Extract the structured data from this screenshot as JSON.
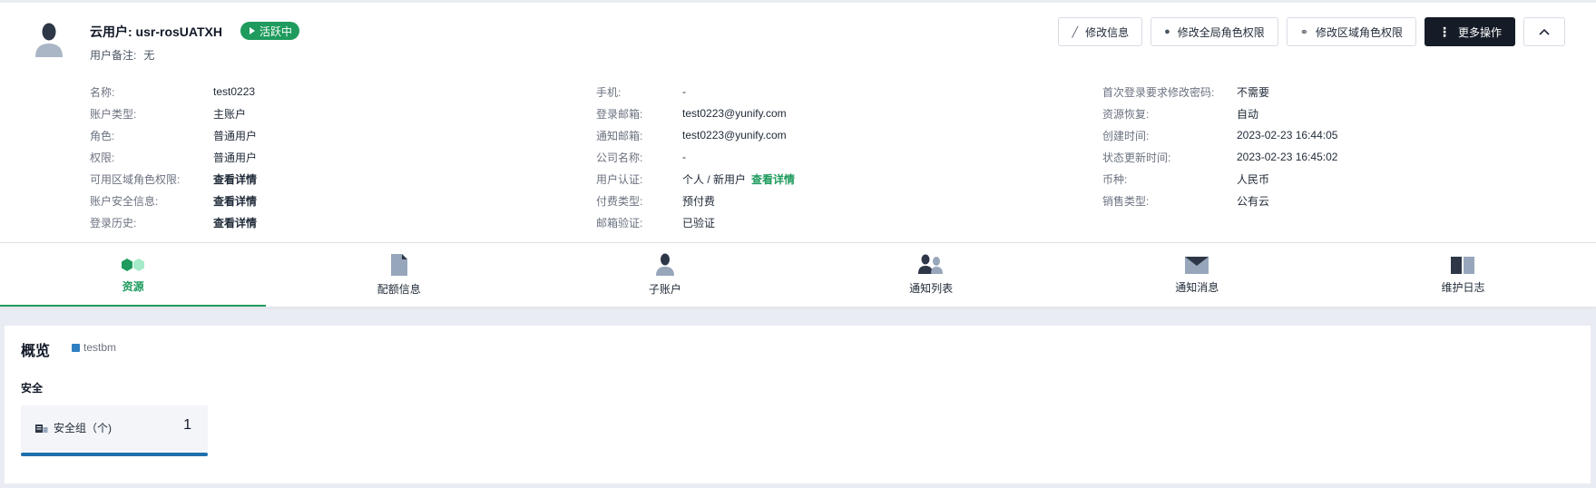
{
  "user": {
    "title": "云用户: usr-rosUATXH",
    "status": "活跃中",
    "remark_label": "用户备注:",
    "remark_value": "无"
  },
  "actions": {
    "edit_info": "修改信息",
    "edit_global_roles": "修改全局角色权限",
    "edit_zone_roles": "修改区域角色权限",
    "more": "更多操作"
  },
  "info": {
    "col1": [
      {
        "k": "名称:",
        "v": "test0223"
      },
      {
        "k": "账户类型:",
        "v": "主账户"
      },
      {
        "k": "角色:",
        "v": "普通用户"
      },
      {
        "k": "权限:",
        "v": "普通用户"
      },
      {
        "k": "可用区域角色权限:",
        "v": "查看详情"
      },
      {
        "k": "账户安全信息:",
        "v": "查看详情"
      },
      {
        "k": "登录历史:",
        "v": "查看详情"
      }
    ],
    "col2": [
      {
        "k": "手机:",
        "v": "-"
      },
      {
        "k": "登录邮箱:",
        "v": "test0223@yunify.com"
      },
      {
        "k": "通知邮箱:",
        "v": "test0223@yunify.com"
      },
      {
        "k": "公司名称:",
        "v": "-"
      },
      {
        "k": "用户认证:",
        "v": "个人 / 新用户",
        "link": "查看详情"
      },
      {
        "k": "付费类型:",
        "v": "预付费"
      },
      {
        "k": "邮箱验证:",
        "v": "已验证"
      }
    ],
    "col3": [
      {
        "k": "首次登录要求修改密码:",
        "v": "不需要"
      },
      {
        "k": "资源恢复:",
        "v": "自动"
      },
      {
        "k": "创建时间:",
        "v": "2023-02-23 16:44:05"
      },
      {
        "k": "状态更新时间:",
        "v": "2023-02-23 16:45:02"
      },
      {
        "k": "币种:",
        "v": "人民币"
      },
      {
        "k": "销售类型:",
        "v": "公有云"
      }
    ]
  },
  "tabs": [
    {
      "label": "资源",
      "icon": "resources-icon"
    },
    {
      "label": "配额信息",
      "icon": "document-icon"
    },
    {
      "label": "子账户",
      "icon": "user-icon"
    },
    {
      "label": "通知列表",
      "icon": "users-icon"
    },
    {
      "label": "通知消息",
      "icon": "mail-icon"
    },
    {
      "label": "维护日志",
      "icon": "book-icon"
    }
  ],
  "overview": {
    "title": "概览",
    "tag": "testbm",
    "section": "安全",
    "card_label": "安全组（个)",
    "card_value": "1"
  },
  "colors": {
    "accent": "#1e9b5d",
    "dark_button": "#151c27",
    "tag": "#2f7fc1",
    "bar": "#1f6fad"
  }
}
